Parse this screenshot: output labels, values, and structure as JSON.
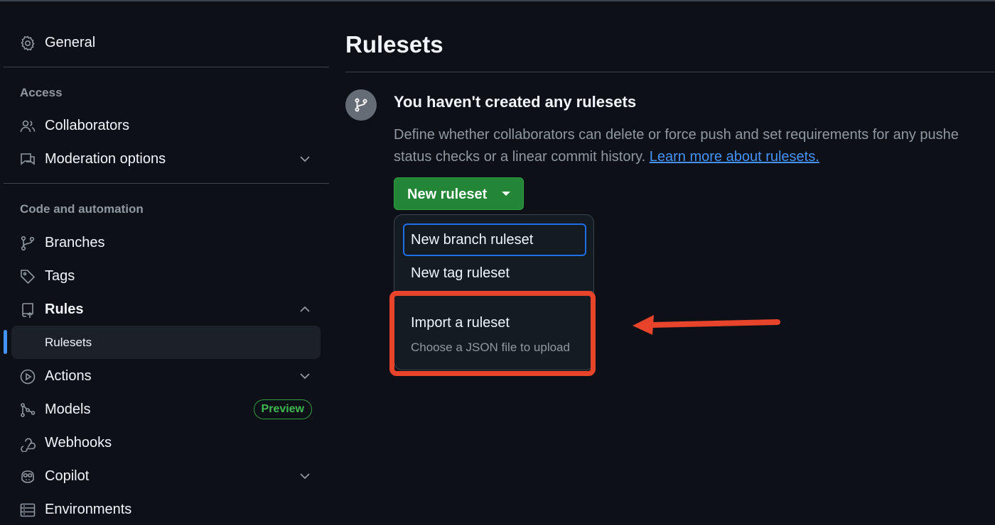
{
  "colors": {
    "background": "#0d1117",
    "accent_blue": "#4493f8",
    "button_green": "#238636",
    "preview_green": "#3fb950",
    "annotation_red": "#e8442b"
  },
  "sidebar": {
    "general": {
      "label": "General",
      "icon": "gear-icon"
    },
    "sections": {
      "access": "Access",
      "code_automation": "Code and automation"
    },
    "items": {
      "collaborators": {
        "label": "Collaborators",
        "icon": "people-icon"
      },
      "moderation": {
        "label": "Moderation options",
        "icon": "report-icon"
      },
      "branches": {
        "label": "Branches",
        "icon": "git-branch-icon"
      },
      "tags": {
        "label": "Tags",
        "icon": "tag-icon"
      },
      "rules": {
        "label": "Rules",
        "icon": "repo-push-icon"
      },
      "rulesets": {
        "label": "Rulesets"
      },
      "actions": {
        "label": "Actions",
        "icon": "play-icon"
      },
      "models": {
        "label": "Models",
        "icon": "models-icon",
        "badge": "Preview"
      },
      "webhooks": {
        "label": "Webhooks",
        "icon": "webhook-icon"
      },
      "copilot": {
        "label": "Copilot",
        "icon": "copilot-icon"
      },
      "environments": {
        "label": "Environments",
        "icon": "server-icon"
      }
    }
  },
  "main": {
    "title": "Rulesets",
    "empty_state": {
      "icon": "git-branch-icon",
      "title": "You haven't created any rulesets",
      "description_line1": "Define whether collaborators can delete or force push and set requirements for any pushe",
      "description_line2": "status checks or a linear commit history. ",
      "link": "Learn more about rulesets."
    },
    "new_button": {
      "label": "New ruleset"
    },
    "menu": {
      "items": [
        {
          "label": "New branch ruleset"
        },
        {
          "label": "New tag ruleset"
        }
      ],
      "import": {
        "label": "Import a ruleset",
        "description": "Choose a JSON file to upload"
      }
    }
  }
}
